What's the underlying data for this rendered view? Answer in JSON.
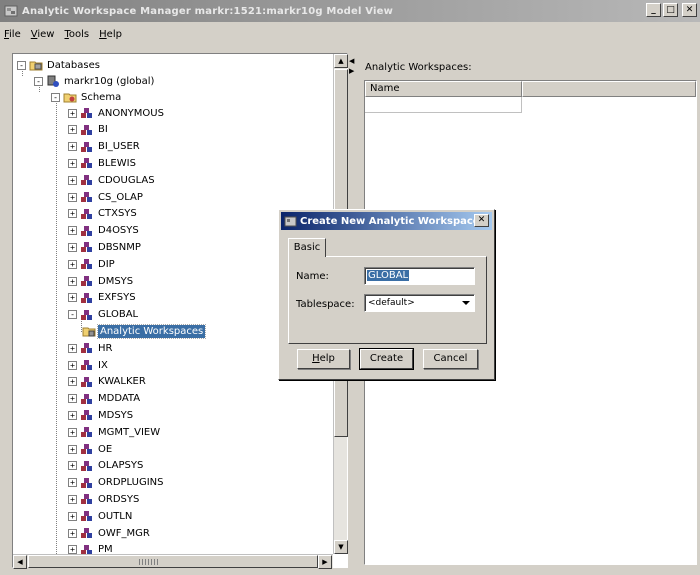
{
  "window": {
    "title": "Analytic Workspace Manager   markr:1521:markr10g   Model View",
    "minimize": "_",
    "maximize": "□",
    "close": "✕"
  },
  "menu": {
    "items": [
      {
        "label": "File",
        "mnemonic": "F",
        "rest": "ile"
      },
      {
        "label": "View",
        "mnemonic": "V",
        "rest": "iew"
      },
      {
        "label": "Tools",
        "mnemonic": "T",
        "rest": "ools"
      },
      {
        "label": "Help",
        "mnemonic": "H",
        "rest": "elp"
      }
    ]
  },
  "tree": {
    "root": "Databases",
    "connection": "markr10g (global)",
    "schema_folder": "Schema",
    "schemas": [
      "ANONYMOUS",
      "BI",
      "BI_USER",
      "BLEWIS",
      "CDOUGLAS",
      "CS_OLAP",
      "CTXSYS",
      "D4OSYS",
      "DBSNMP",
      "DIP",
      "DMSYS",
      "EXFSYS",
      "GLOBAL",
      "HR",
      "IX",
      "KWALKER",
      "MDDATA",
      "MDSYS",
      "MGMT_VIEW",
      "OE",
      "OLAPSYS",
      "ORDPLUGINS",
      "ORDSYS",
      "OUTLN",
      "OWF_MGR",
      "PM"
    ],
    "expanded_schema": "GLOBAL",
    "selected_child": "Analytic Workspaces",
    "toggle_collapsed": "+",
    "toggle_expanded": "-"
  },
  "right_panel": {
    "label": "Analytic Workspaces:",
    "table_header": "Name"
  },
  "dialog": {
    "title": "Create New Analytic Workspace",
    "close": "✕",
    "tab": "Basic",
    "name_label": "Name:",
    "name_value": "GLOBAL",
    "tablespace_label": "Tablespace:",
    "tablespace_value": "<default>",
    "buttons": {
      "help": {
        "mnemonic": "H",
        "rest": "elp"
      },
      "create": "Create",
      "cancel": "Cancel"
    }
  },
  "colors": {
    "dialog_title_start": "#0a246a",
    "dialog_title_end": "#a6caf0",
    "selection": "#3a6ea5",
    "window_face": "#d4d0c8"
  }
}
